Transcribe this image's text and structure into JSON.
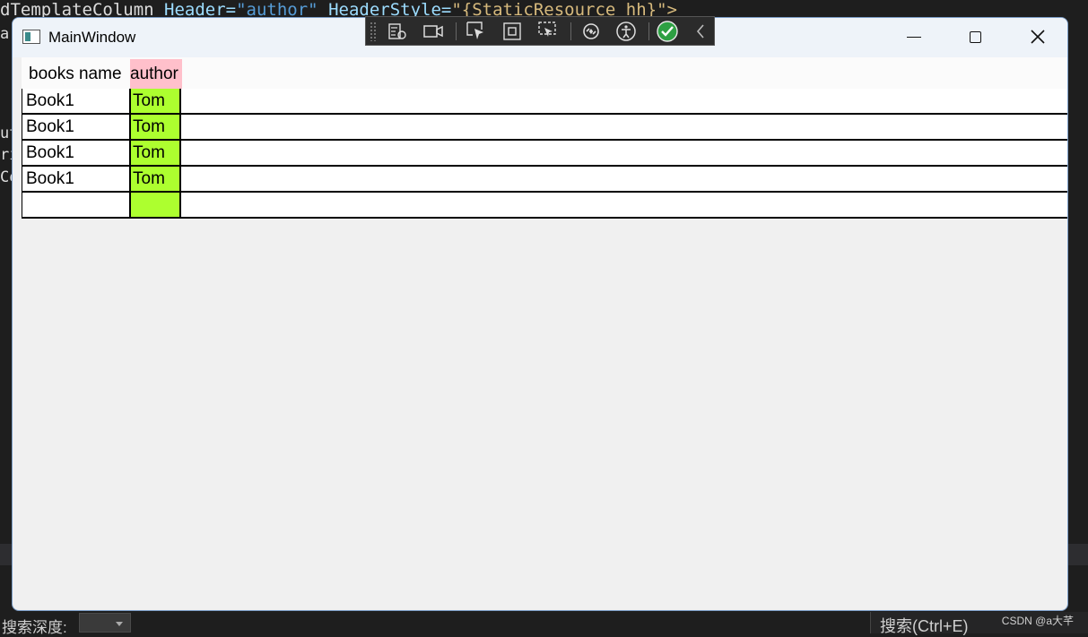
{
  "ide": {
    "code_line": {
      "prefix": "dTemplateColumn ",
      "attr1": "Header=",
      "val1": "\"author\"",
      "attr2": " HeaderStyle=",
      "val2": "\"{StaticResource hh}\">"
    },
    "left_fragments": [
      "a",
      "ut",
      "ri",
      "Co"
    ],
    "status": {
      "search_depth_label": "搜索深度:",
      "search_placeholder": "搜索(Ctrl+E)"
    },
    "watermark": "CSDN @a大芊"
  },
  "window": {
    "title": "MainWindow",
    "controls": {
      "minimize": "minimize",
      "maximize": "maximize",
      "close": "close"
    }
  },
  "debug_toolbar": {
    "icons": [
      "live-visual-tree-icon",
      "record-icon",
      "select-element-icon",
      "display-layout-adorners-icon",
      "track-focus-icon",
      "hot-reload-icon",
      "accessibility-icon",
      "binding-check-icon",
      "collapse-icon"
    ]
  },
  "grid": {
    "columns": [
      "books name",
      "author"
    ],
    "header_colors": {
      "author": "#ffc0cb"
    },
    "author_cell_color": "#adff2f",
    "rows": [
      {
        "name": "Book1",
        "author": "Tom"
      },
      {
        "name": "Book1",
        "author": "Tom"
      },
      {
        "name": "Book1",
        "author": "Tom"
      },
      {
        "name": "Book1",
        "author": "Tom"
      },
      {
        "name": "",
        "author": ""
      }
    ]
  }
}
